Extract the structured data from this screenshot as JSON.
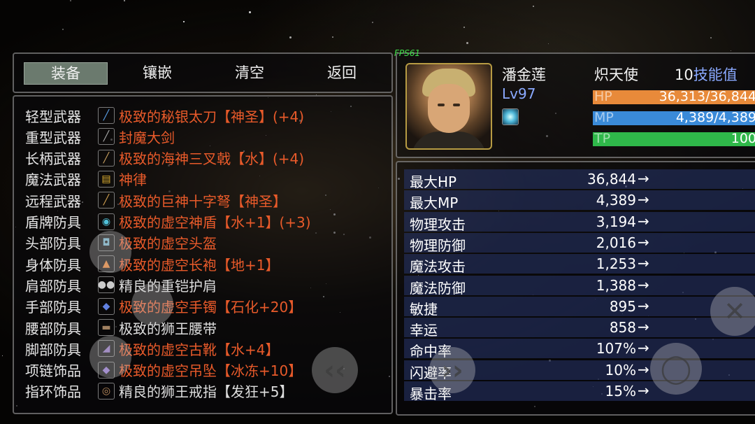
{
  "tabs": [
    {
      "label": "装备",
      "active": true
    },
    {
      "label": "镶嵌",
      "active": false
    },
    {
      "label": "清空",
      "active": false
    },
    {
      "label": "返回",
      "active": false
    }
  ],
  "equipment": [
    {
      "slot": "轻型武器",
      "icon": "katana-icon",
      "glyph": "╱",
      "name": "极致的秘银太刀【神圣】(+4)",
      "color": "orange"
    },
    {
      "slot": "重型武器",
      "icon": "greatsword-icon",
      "glyph": "╱",
      "name": "封魔大剑",
      "color": "orange"
    },
    {
      "slot": "长柄武器",
      "icon": "trident-icon",
      "glyph": "╱",
      "name": "极致的海神三叉戟【水】(+4)",
      "color": "orange"
    },
    {
      "slot": "魔法武器",
      "icon": "book-icon",
      "glyph": "▤",
      "name": "神律",
      "color": "orange"
    },
    {
      "slot": "远程武器",
      "icon": "crossbow-icon",
      "glyph": "╱",
      "name": "极致的巨神十字弩【神圣】",
      "color": "orange"
    },
    {
      "slot": "盾牌防具",
      "icon": "shield-icon",
      "glyph": "◉",
      "name": "极致的虚空神盾【水+1】(+3)",
      "color": "orange"
    },
    {
      "slot": "头部防具",
      "icon": "helmet-icon",
      "glyph": "◘",
      "name": "极致的虚空头盔",
      "color": "orange"
    },
    {
      "slot": "身体防具",
      "icon": "robe-icon",
      "glyph": "▲",
      "name": "极致的虚空长袍【地+1】",
      "color": "orange"
    },
    {
      "slot": "肩部防具",
      "icon": "pauldron-icon",
      "glyph": "●●",
      "name": "精良的重铠护肩",
      "color": "white"
    },
    {
      "slot": "手部防具",
      "icon": "bracelet-icon",
      "glyph": "◆",
      "name": "极致的虚空手镯【石化+20】",
      "color": "orange"
    },
    {
      "slot": "腰部防具",
      "icon": "belt-icon",
      "glyph": "▬",
      "name": "极致的狮王腰带",
      "color": "white"
    },
    {
      "slot": "脚部防具",
      "icon": "boots-icon",
      "glyph": "◢",
      "name": "极致的虚空古靴【水+4】",
      "color": "orange"
    },
    {
      "slot": "项链饰品",
      "icon": "pendant-icon",
      "glyph": "◆",
      "name": "极致的虚空吊坠【冰冻+10】",
      "color": "orange"
    },
    {
      "slot": "指环饰品",
      "icon": "ring-icon",
      "glyph": "◎",
      "name": "精良的狮王戒指【发狂+5】",
      "color": "white"
    }
  ],
  "character": {
    "fps": "FPS61",
    "name": "潘金莲",
    "level": "Lv97",
    "class": "炽天使",
    "skill_points_num": "10",
    "skill_points_label": "技能值",
    "hp_label": "HP",
    "hp_text": "36,313/36,844",
    "hp_ratio": 0.985,
    "mp_label": "MP",
    "mp_text": "4,389/4,389",
    "mp_ratio": 1.0,
    "tp_label": "TP",
    "tp_text": "100",
    "tp_ratio": 1.0,
    "colors": {
      "hp": "#e88a3a",
      "mp": "#3a8ad8",
      "tp": "#2fb84a",
      "level": "#8aa9ff",
      "equip_orange": "#e85a2a"
    }
  },
  "stats": [
    {
      "label": "最大HP",
      "value": "36,844",
      "arrow": "→"
    },
    {
      "label": "最大MP",
      "value": "4,389",
      "arrow": "→"
    },
    {
      "label": "物理攻击",
      "value": "3,194",
      "arrow": "→"
    },
    {
      "label": "物理防御",
      "value": "2,016",
      "arrow": "→"
    },
    {
      "label": "魔法攻击",
      "value": "1,253",
      "arrow": "→"
    },
    {
      "label": "魔法防御",
      "value": "1,388",
      "arrow": "→"
    },
    {
      "label": "敏捷",
      "value": "895",
      "arrow": "→"
    },
    {
      "label": "幸运",
      "value": "858",
      "arrow": "→"
    },
    {
      "label": "命中率",
      "value": "107%",
      "arrow": "→"
    },
    {
      "label": "闪避率",
      "value": "10%",
      "arrow": "→"
    },
    {
      "label": "暴击率",
      "value": "15%",
      "arrow": "→"
    }
  ],
  "controls": {
    "left": "‹‹",
    "right": "››",
    "close": "✕",
    "confirm": "◯"
  }
}
